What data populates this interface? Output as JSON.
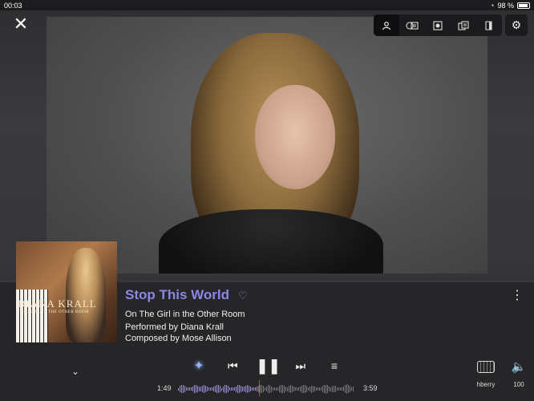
{
  "status": {
    "time": "00:03",
    "battery": "98 %"
  },
  "header": {
    "views": [
      {
        "icon": "person-icon",
        "glyph": "👤"
      },
      {
        "icon": "album-info-icon",
        "glyph": "◫"
      },
      {
        "icon": "record-icon",
        "glyph": "◉"
      },
      {
        "icon": "credits-icon",
        "glyph": "▤"
      },
      {
        "icon": "booklet-icon",
        "glyph": "▮"
      }
    ],
    "active_view": 0
  },
  "album": {
    "cover_artist": "DIANA KRALL",
    "cover_subtitle": "THE GIRL IN THE OTHER ROOM"
  },
  "track": {
    "title": "Stop This World",
    "album_line": "On The Girl in the Other Room",
    "performer_line": "Performed by Diana Krall",
    "composer_line": "Composed by Mose Allison",
    "favorite": false
  },
  "playback": {
    "elapsed": "1:49",
    "duration": "3:59",
    "progress": 0.456,
    "state": "playing"
  },
  "device": {
    "name": "hberry"
  },
  "volume": {
    "level": "100"
  },
  "colors": {
    "accent": "#8c87e8",
    "playhead": "#c24848",
    "background": "#262628"
  }
}
